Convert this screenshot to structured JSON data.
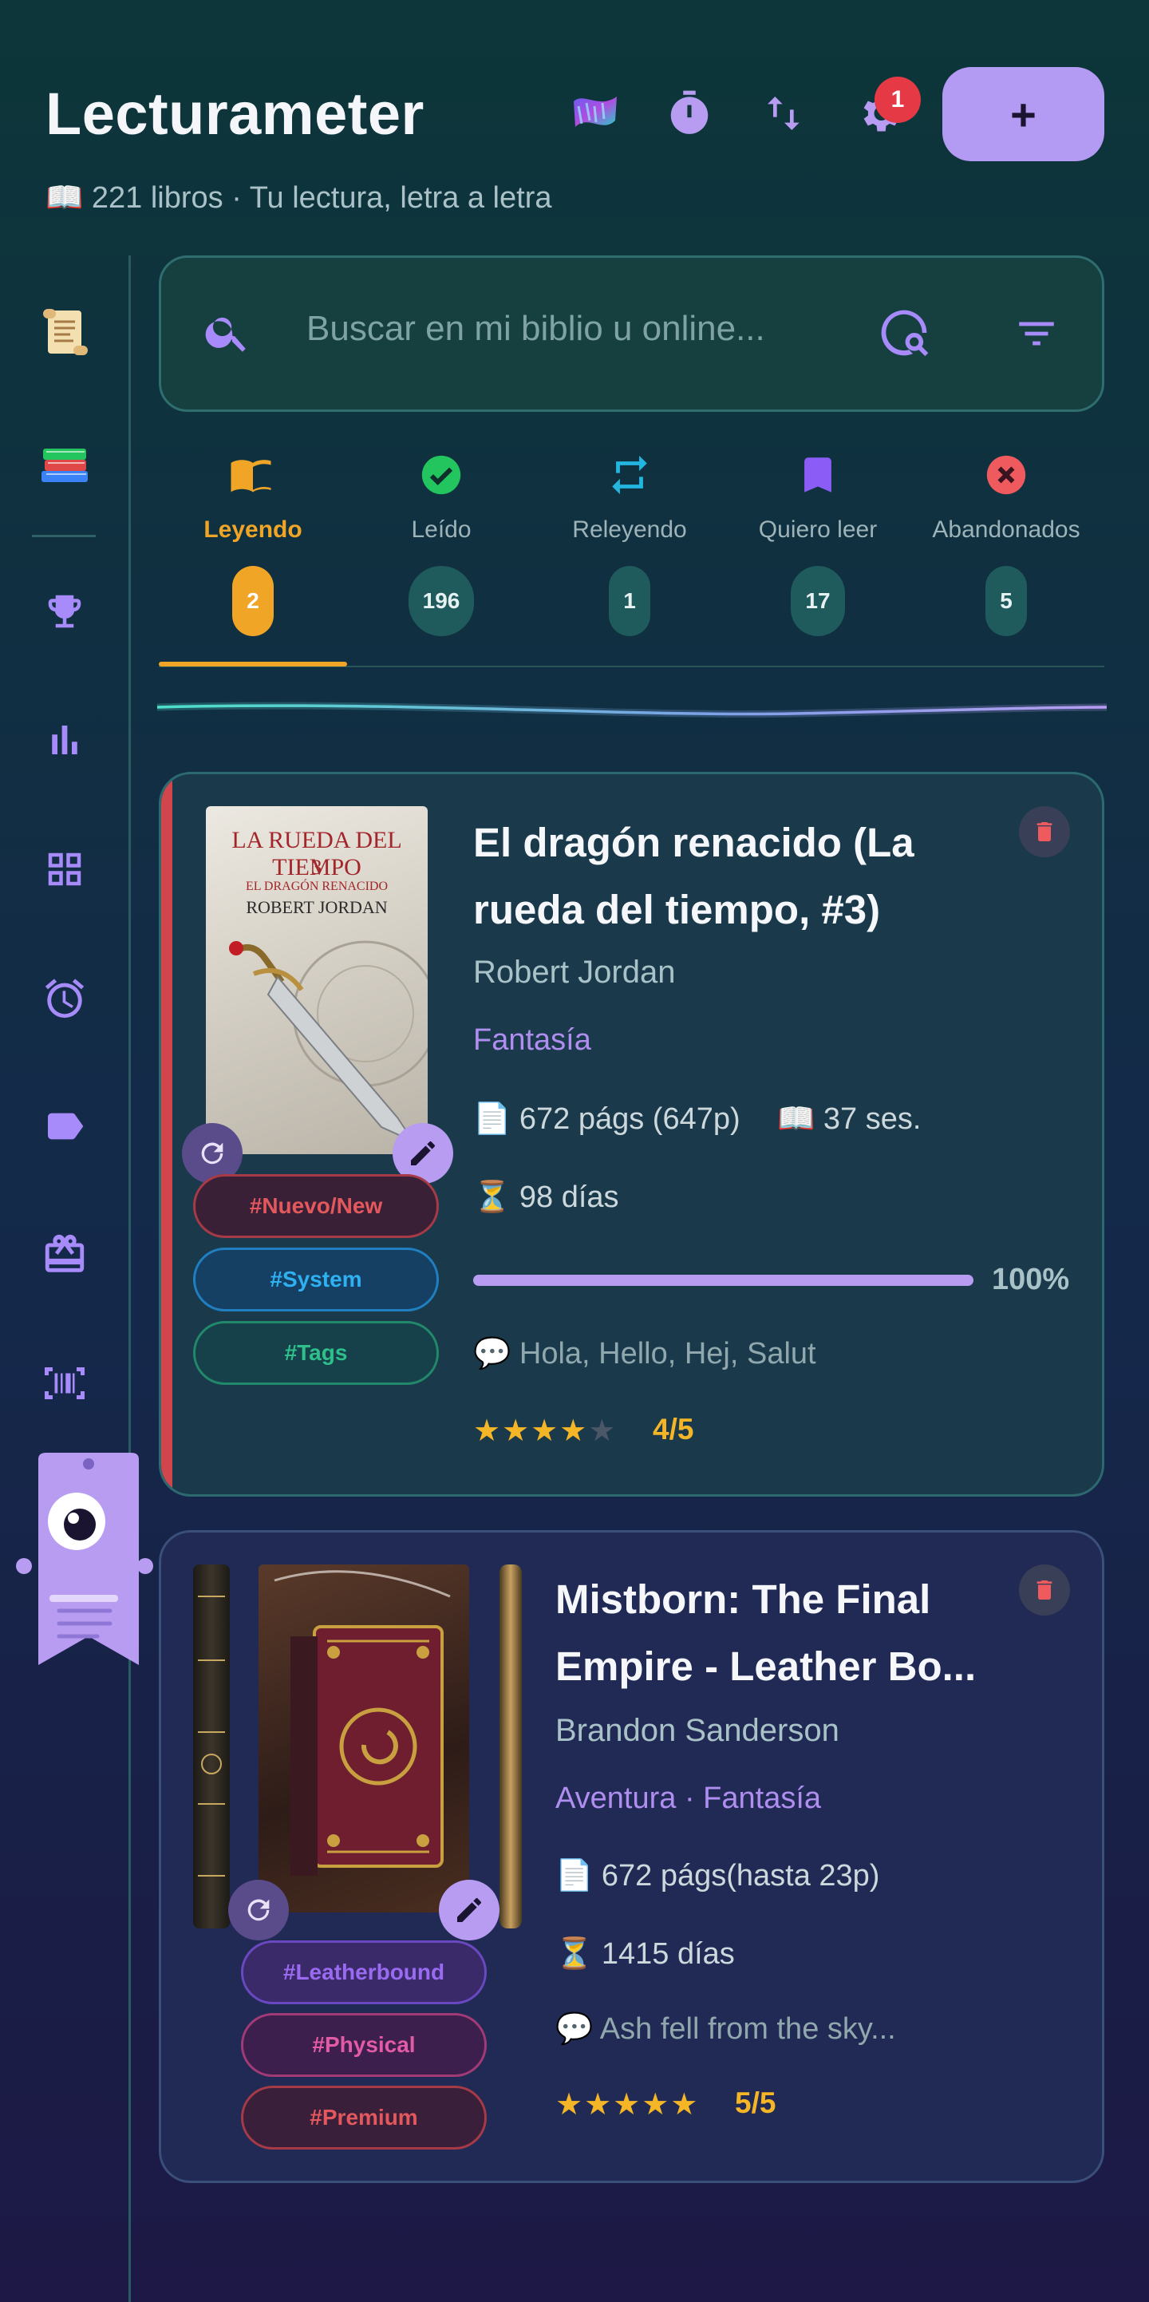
{
  "header": {
    "title": "Lecturameter",
    "subtitle": "📖 221 libros · Tu lectura, letra a letra",
    "notifications_count": "1",
    "add_label": "+"
  },
  "search": {
    "placeholder": "Buscar en mi biblio u online..."
  },
  "tabs": [
    {
      "label": "Leyendo",
      "count": "2",
      "icon": "book-open-icon",
      "color": "#f0a526"
    },
    {
      "label": "Leído",
      "count": "196",
      "icon": "check-circle-icon",
      "color": "#22c55e"
    },
    {
      "label": "Releyendo",
      "count": "1",
      "icon": "repeat-icon",
      "color": "#22b6e0"
    },
    {
      "label": "Quiero leer",
      "count": "17",
      "icon": "bookmark-icon",
      "color": "#8b5cf6"
    },
    {
      "label": "Abandonados",
      "count": "5",
      "icon": "x-circle-icon",
      "color": "#ef5a5f"
    }
  ],
  "sidebar": {
    "items": [
      "scroll-icon",
      "books-icon",
      "trophy-icon",
      "bar-chart-icon",
      "grid-icon",
      "alarm-icon",
      "label-icon",
      "gift-icon",
      "barcode-icon"
    ]
  },
  "books": [
    {
      "title_line1": "El dragón renacido (La",
      "title_line2": "rueda del tiempo, #3)",
      "author": "Robert Jordan",
      "genres": "Fantasía",
      "pages": "📄 672 págs (647p)",
      "sessions": "📖 37 ses.",
      "days": "⏳ 98 días",
      "progress": 100,
      "progress_label": "100%",
      "quote": "💬 Hola, Hello, Hej, Salut",
      "stars": 4,
      "rating": "4/5",
      "tags": [
        "#Nuevo/New",
        "#System",
        "#Tags"
      ],
      "cover": {
        "line1": "LA RUEDA DEL TIEMPO",
        "num": "3",
        "line2": "EL DRAGÓN RENACIDO",
        "author": "ROBERT JORDAN"
      },
      "accent": "#d0464c"
    },
    {
      "title_line1": "Mistborn: The Final",
      "title_line2": "Empire - Leather Bo...",
      "author": "Brandon Sanderson",
      "genres": "Aventura · Fantasía",
      "pages": "📄 672 págs(hasta 23p)",
      "days": "⏳ 1415 días",
      "quote": "💬 Ash fell from the sky...",
      "stars": 5,
      "rating": "5/5",
      "tags": [
        "#Leatherbound",
        "#Physical",
        "#Premium"
      ]
    }
  ]
}
